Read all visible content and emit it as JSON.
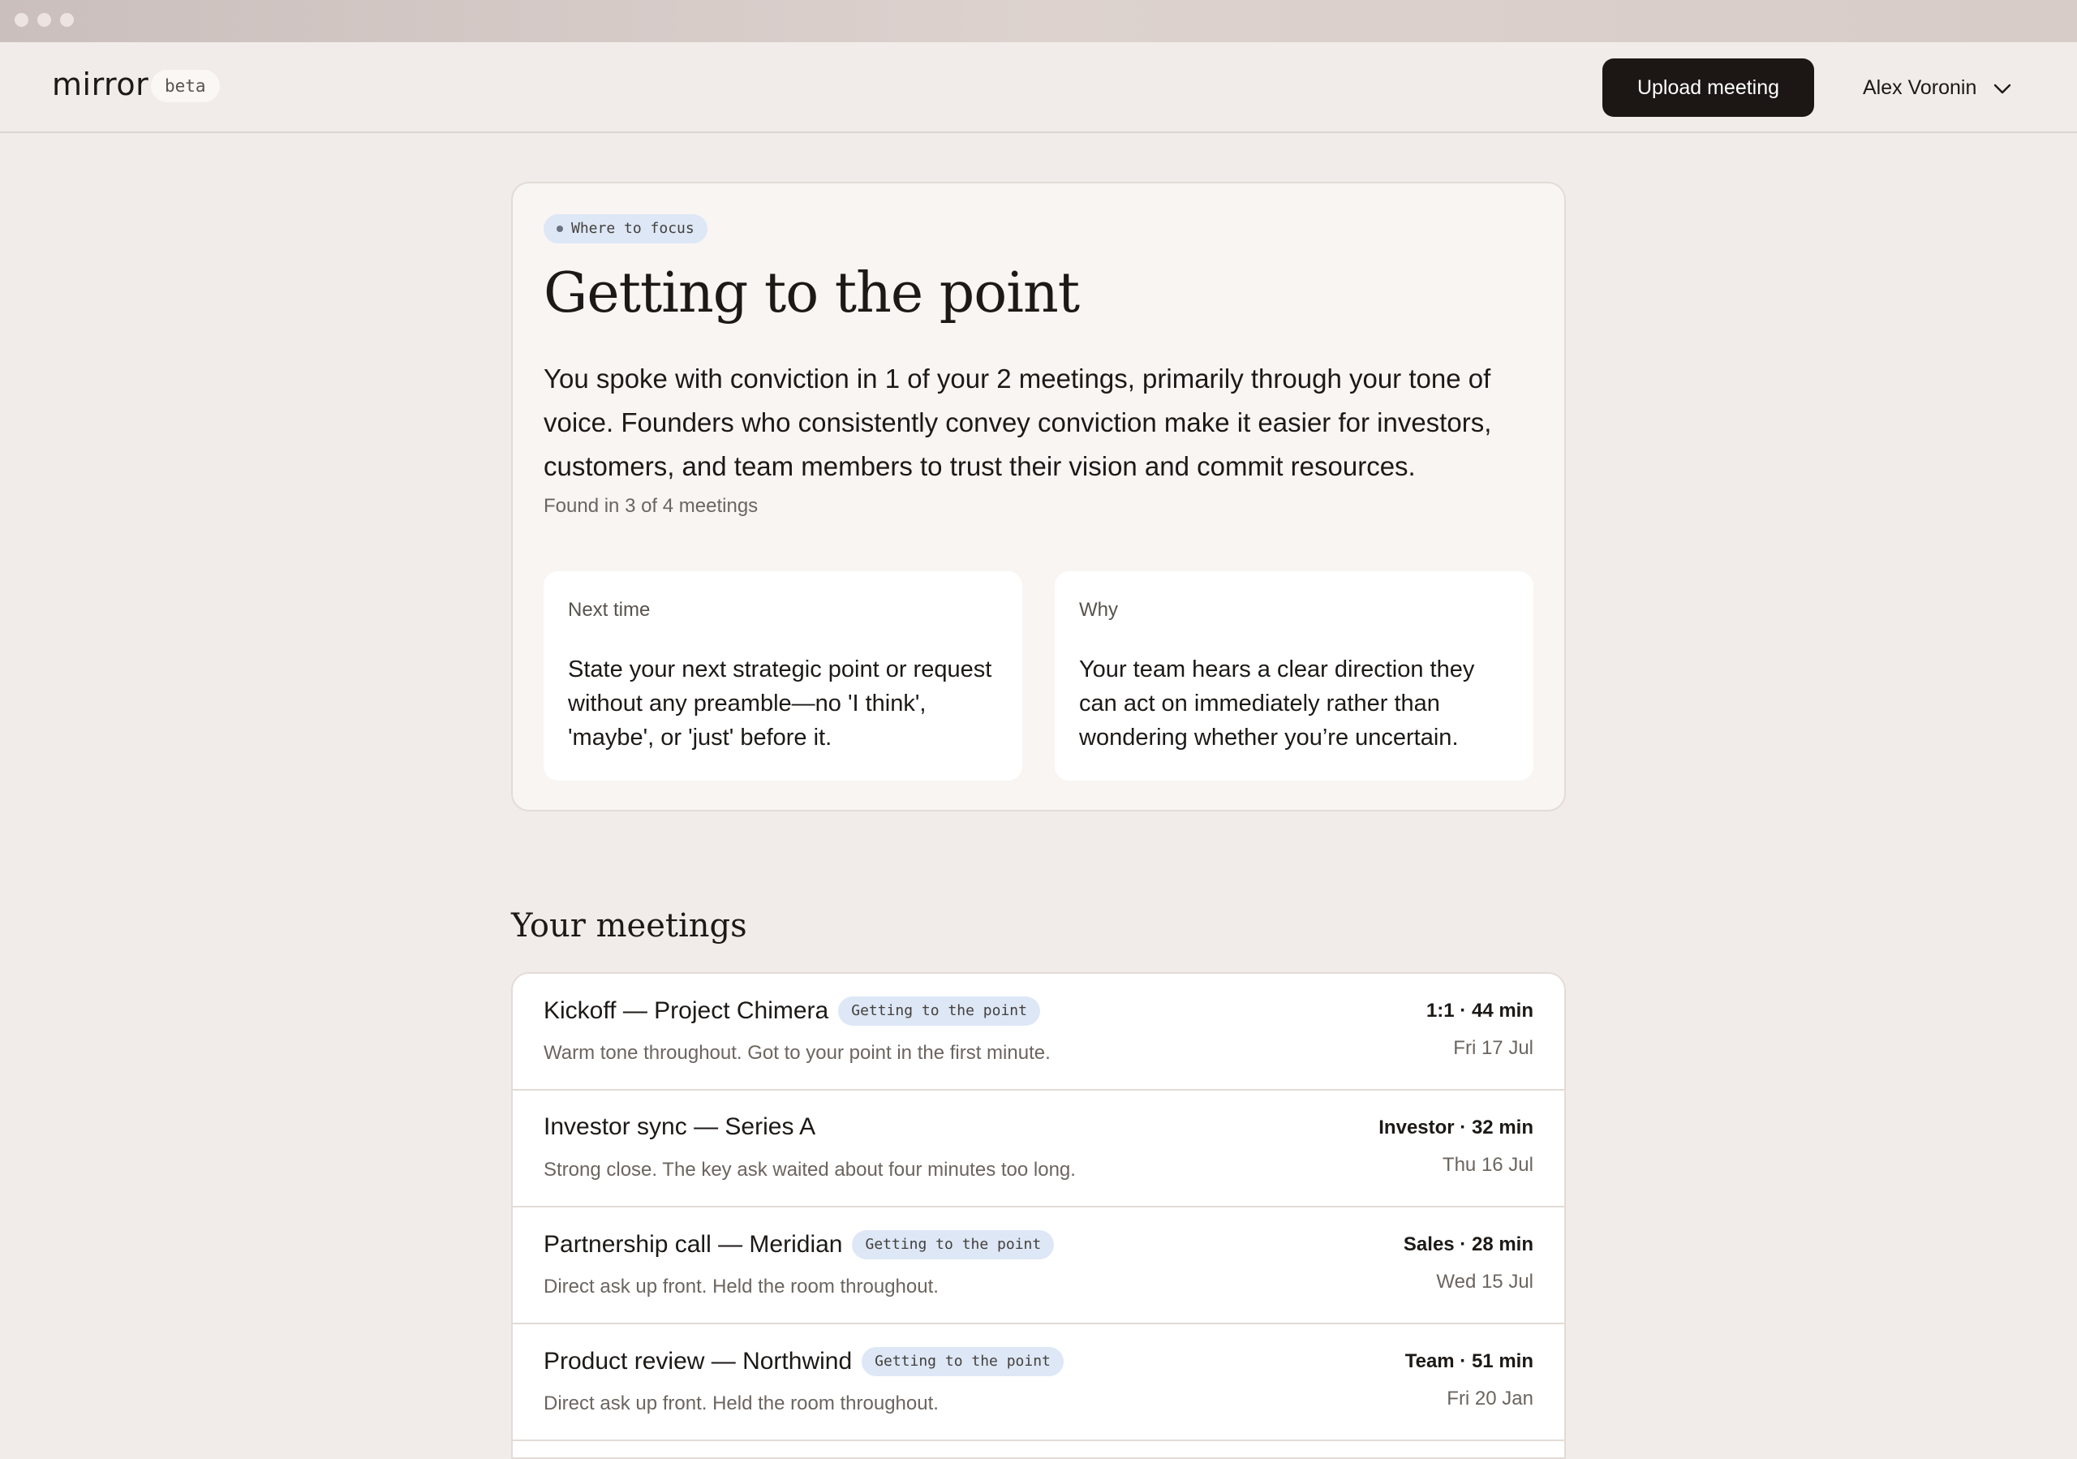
{
  "header": {
    "logo": "mirror",
    "badge": "beta",
    "upload_label": "Upload meeting",
    "user_name": "Alex Voronin"
  },
  "focus": {
    "pill": "Where to focus",
    "title": "Getting to the point",
    "body": "You spoke with conviction in 1 of your 2 meetings, primarily through your tone of voice. Founders who consistently convey conviction make it easier for investors, customers, and team members to trust their vision and commit resources.",
    "found": "Found in 3 of 4 meetings",
    "next": {
      "label": "Next time",
      "text": "State your next strategic point or request without any preamble—no 'I think', 'maybe', or 'just' before it."
    },
    "why": {
      "label": "Why",
      "text": "Your team hears a clear direction they can act on immediately rather than wondering whether you’re uncertain."
    }
  },
  "meetings": {
    "title": "Your meetings",
    "items": [
      {
        "title": "Kickoff — Project Chimera",
        "tag": "Getting to the point",
        "desc": "Warm tone throughout. Got to your point in the first minute.",
        "type": "1:1 · 44 min",
        "date": "Fri 17 Jul"
      },
      {
        "title": "Investor sync — Series A",
        "tag": "",
        "desc": "Strong close. The key ask waited about four minutes too long.",
        "type": "Investor · 32 min",
        "date": "Thu 16 Jul"
      },
      {
        "title": "Partnership call — Meridian",
        "tag": "Getting to the point",
        "desc": "Direct ask up front. Held the room throughout.",
        "type": "Sales · 28 min",
        "date": "Wed 15 Jul"
      },
      {
        "title": "Product review — Northwind",
        "tag": "Getting to the point",
        "desc": "Direct ask up front. Held the room throughout.",
        "type": "Team · 51 min",
        "date": "Fri 20 Jan"
      }
    ]
  },
  "icons": {
    "chevron": "chevron-down-icon",
    "window_dots": "window-control-icon"
  }
}
